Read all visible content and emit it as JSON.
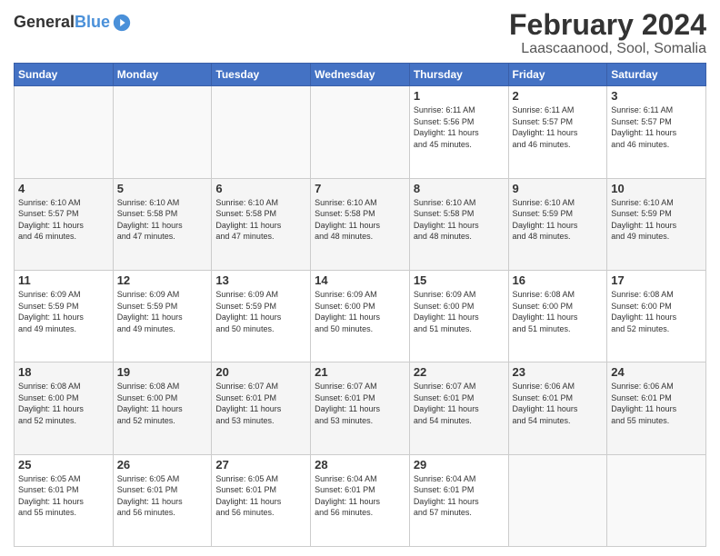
{
  "header": {
    "logo_line1": "General",
    "logo_line2": "Blue",
    "title": "February 2024",
    "subtitle": "Laascaanood, Sool, Somalia"
  },
  "calendar": {
    "days_of_week": [
      "Sunday",
      "Monday",
      "Tuesday",
      "Wednesday",
      "Thursday",
      "Friday",
      "Saturday"
    ],
    "weeks": [
      [
        {
          "day": "",
          "empty": true
        },
        {
          "day": "",
          "empty": true
        },
        {
          "day": "",
          "empty": true
        },
        {
          "day": "",
          "empty": true
        },
        {
          "day": "1",
          "sunrise": "6:11 AM",
          "sunset": "5:56 PM",
          "hours": "11 hours and 45 minutes."
        },
        {
          "day": "2",
          "sunrise": "6:11 AM",
          "sunset": "5:57 PM",
          "hours": "11 hours and 46 minutes."
        },
        {
          "day": "3",
          "sunrise": "6:11 AM",
          "sunset": "5:57 PM",
          "hours": "11 hours and 46 minutes."
        }
      ],
      [
        {
          "day": "4",
          "sunrise": "6:10 AM",
          "sunset": "5:57 PM",
          "hours": "11 hours and 46 minutes."
        },
        {
          "day": "5",
          "sunrise": "6:10 AM",
          "sunset": "5:58 PM",
          "hours": "11 hours and 47 minutes."
        },
        {
          "day": "6",
          "sunrise": "6:10 AM",
          "sunset": "5:58 PM",
          "hours": "11 hours and 47 minutes."
        },
        {
          "day": "7",
          "sunrise": "6:10 AM",
          "sunset": "5:58 PM",
          "hours": "11 hours and 48 minutes."
        },
        {
          "day": "8",
          "sunrise": "6:10 AM",
          "sunset": "5:58 PM",
          "hours": "11 hours and 48 minutes."
        },
        {
          "day": "9",
          "sunrise": "6:10 AM",
          "sunset": "5:59 PM",
          "hours": "11 hours and 48 minutes."
        },
        {
          "day": "10",
          "sunrise": "6:10 AM",
          "sunset": "5:59 PM",
          "hours": "11 hours and 49 minutes."
        }
      ],
      [
        {
          "day": "11",
          "sunrise": "6:09 AM",
          "sunset": "5:59 PM",
          "hours": "11 hours and 49 minutes."
        },
        {
          "day": "12",
          "sunrise": "6:09 AM",
          "sunset": "5:59 PM",
          "hours": "11 hours and 49 minutes."
        },
        {
          "day": "13",
          "sunrise": "6:09 AM",
          "sunset": "5:59 PM",
          "hours": "11 hours and 50 minutes."
        },
        {
          "day": "14",
          "sunrise": "6:09 AM",
          "sunset": "6:00 PM",
          "hours": "11 hours and 50 minutes."
        },
        {
          "day": "15",
          "sunrise": "6:09 AM",
          "sunset": "6:00 PM",
          "hours": "11 hours and 51 minutes."
        },
        {
          "day": "16",
          "sunrise": "6:08 AM",
          "sunset": "6:00 PM",
          "hours": "11 hours and 51 minutes."
        },
        {
          "day": "17",
          "sunrise": "6:08 AM",
          "sunset": "6:00 PM",
          "hours": "11 hours and 52 minutes."
        }
      ],
      [
        {
          "day": "18",
          "sunrise": "6:08 AM",
          "sunset": "6:00 PM",
          "hours": "11 hours and 52 minutes."
        },
        {
          "day": "19",
          "sunrise": "6:08 AM",
          "sunset": "6:00 PM",
          "hours": "11 hours and 52 minutes."
        },
        {
          "day": "20",
          "sunrise": "6:07 AM",
          "sunset": "6:01 PM",
          "hours": "11 hours and 53 minutes."
        },
        {
          "day": "21",
          "sunrise": "6:07 AM",
          "sunset": "6:01 PM",
          "hours": "11 hours and 53 minutes."
        },
        {
          "day": "22",
          "sunrise": "6:07 AM",
          "sunset": "6:01 PM",
          "hours": "11 hours and 54 minutes."
        },
        {
          "day": "23",
          "sunrise": "6:06 AM",
          "sunset": "6:01 PM",
          "hours": "11 hours and 54 minutes."
        },
        {
          "day": "24",
          "sunrise": "6:06 AM",
          "sunset": "6:01 PM",
          "hours": "11 hours and 55 minutes."
        }
      ],
      [
        {
          "day": "25",
          "sunrise": "6:05 AM",
          "sunset": "6:01 PM",
          "hours": "11 hours and 55 minutes."
        },
        {
          "day": "26",
          "sunrise": "6:05 AM",
          "sunset": "6:01 PM",
          "hours": "11 hours and 56 minutes."
        },
        {
          "day": "27",
          "sunrise": "6:05 AM",
          "sunset": "6:01 PM",
          "hours": "11 hours and 56 minutes."
        },
        {
          "day": "28",
          "sunrise": "6:04 AM",
          "sunset": "6:01 PM",
          "hours": "11 hours and 56 minutes."
        },
        {
          "day": "29",
          "sunrise": "6:04 AM",
          "sunset": "6:01 PM",
          "hours": "11 hours and 57 minutes."
        },
        {
          "day": "",
          "empty": true
        },
        {
          "day": "",
          "empty": true
        }
      ]
    ]
  }
}
